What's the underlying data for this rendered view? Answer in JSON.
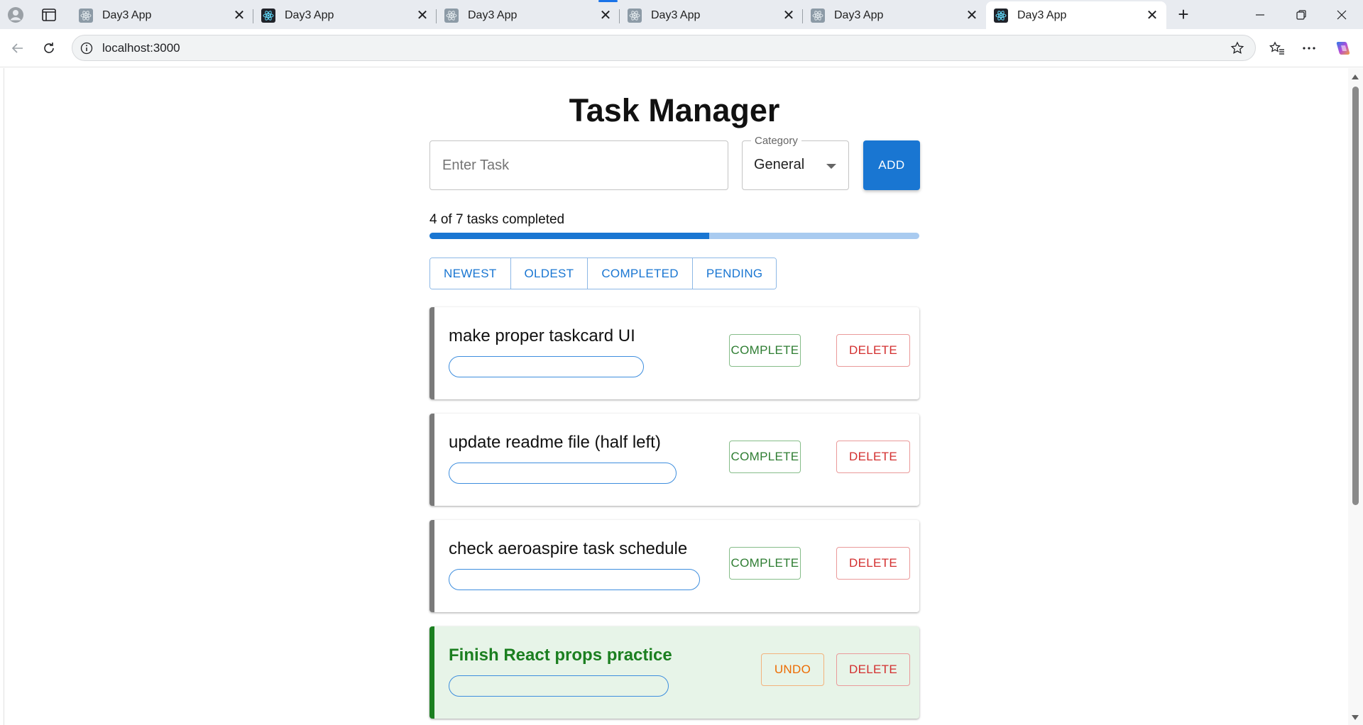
{
  "browser": {
    "tabs": [
      {
        "title": "Day3 App",
        "active": false
      },
      {
        "title": "Day3 App",
        "active": false
      },
      {
        "title": "Day3 App",
        "active": false
      },
      {
        "title": "Day3 App",
        "active": false
      },
      {
        "title": "Day3 App",
        "active": false
      },
      {
        "title": "Day3 App",
        "active": true
      }
    ],
    "url": "localhost:3000"
  },
  "app": {
    "title": "Task Manager",
    "task_input": {
      "placeholder": "Enter Task",
      "value": ""
    },
    "category": {
      "label": "Category",
      "value": "General"
    },
    "add_label": "ADD",
    "progress": {
      "text": "4 of 7 tasks completed",
      "completed": 4,
      "total": 7
    },
    "filters": [
      "NEWEST",
      "OLDEST",
      "COMPLETED",
      "PENDING"
    ],
    "tasks": [
      {
        "text": "make proper taskcard UI",
        "completed": false,
        "action_label": "COMPLETE",
        "delete_label": "DELETE"
      },
      {
        "text": "update readme file (half left)",
        "completed": false,
        "action_label": "COMPLETE",
        "delete_label": "DELETE"
      },
      {
        "text": "check aeroaspire task schedule",
        "completed": false,
        "action_label": "COMPLETE",
        "delete_label": "DELETE"
      },
      {
        "text": "Finish React props practice",
        "completed": true,
        "action_label": "UNDO",
        "delete_label": "DELETE"
      }
    ]
  },
  "colors": {
    "primary": "#1976d2",
    "success": "#2e7d32",
    "warning": "#ed6c02",
    "error": "#d32f2f",
    "completed_card_bg": "#e7f4e8"
  }
}
